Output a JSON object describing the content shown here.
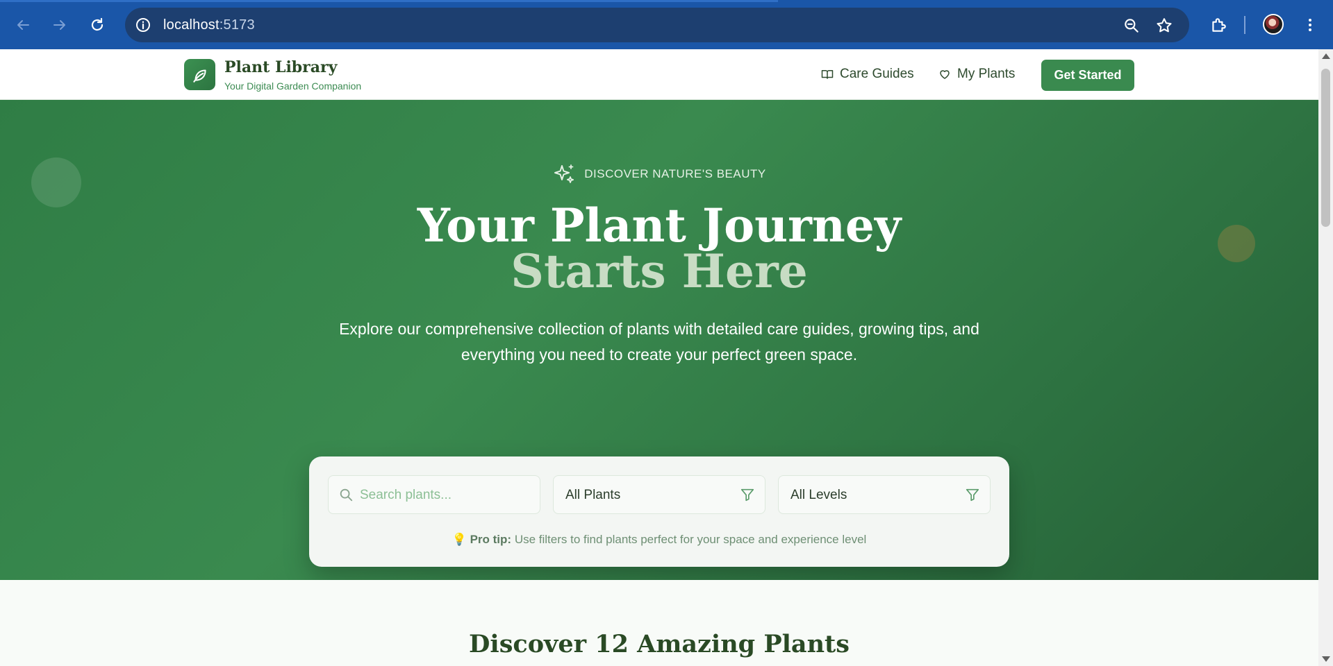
{
  "browser": {
    "url_host": "localhost",
    "url_port": ":5173"
  },
  "site": {
    "brand_title": "Plant Library",
    "brand_subtitle": "Your Digital Garden Companion",
    "nav": {
      "care_guides": "Care Guides",
      "my_plants": "My Plants",
      "cta": "Get Started"
    }
  },
  "hero": {
    "eyebrow": "DISCOVER NATURE'S BEAUTY",
    "title_line1": "Your Plant Journey",
    "title_line2": "Starts Here",
    "lead": "Explore our comprehensive collection of plants with detailed care guides, growing tips, and everything you need to create your perfect green space."
  },
  "search": {
    "placeholder": "Search plants...",
    "category_value": "All Plants",
    "level_value": "All Levels",
    "tip_label": "Pro tip:",
    "tip_text": "Use filters to find plants perfect for your space and experience level"
  },
  "discover": {
    "heading": "Discover 12 Amazing Plants"
  },
  "colors": {
    "brand_green": "#3a8a4f",
    "chrome_blue": "#1a56a8",
    "heading_dark": "#2a4a25"
  }
}
